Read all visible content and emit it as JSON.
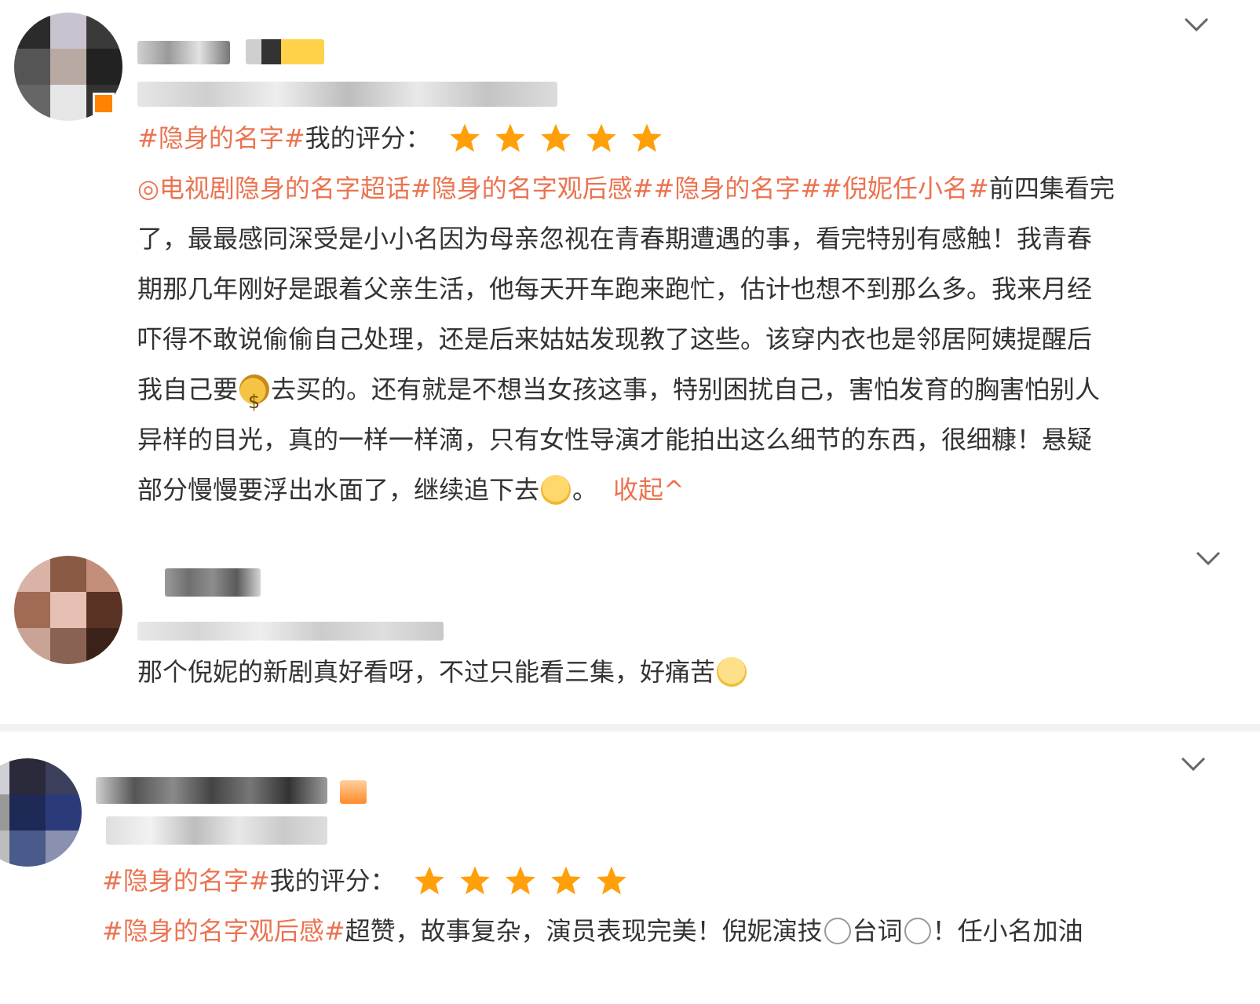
{
  "accent_color": "#eb7350",
  "star_color": "#ff9f0a",
  "posts": [
    {
      "rating_tag": "#隐身的名字#",
      "rating_label": "我的评分：",
      "stars": 5,
      "body": {
        "l1_tags": "◎电视剧隐身的名字超话#隐身的名字观后感##隐身的名字##倪妮任小名#",
        "l1_text": " 前四集看完",
        "l2": "了，最最感同深受是小小名因为母亲忽视在青春期遭遇的事，看完特别有感触！我青春",
        "l3": "期那几年刚好是跟着父亲生活，他每天开车跑来跑忙，估计也想不到那么多。我来月经",
        "l4": "吓得不敢说偷偷自己处理，还是后来姑姑发现教了这些。该穿内衣也是邻居阿姨提醒后",
        "l5a": "我自己要",
        "l5b": "去买的。还有就是不想当女孩这事，特别困扰自己，害怕发育的胸害怕别人",
        "l6": "异样的目光，真的一样一样滴，只有女性导演才能拍出这么细节的东西，很细糠！悬疑",
        "l7": "部分慢慢要浮出水面了，继续追下去",
        "l7_end": "。",
        "collapse": "收起^"
      },
      "icons": {
        "emoji_1": "money-bag-emoji",
        "emoji_2": "crying-face-emoji",
        "menu": "chevron-down-icon"
      }
    },
    {
      "body": "那个倪妮的新剧真好看呀，不过只能看三集，好痛苦",
      "icons": {
        "emoji": "smiling-face-emoji",
        "menu": "chevron-down-icon"
      }
    },
    {
      "rating_tag": "#隐身的名字#",
      "rating_label": "我的评分：",
      "stars": 5,
      "body": {
        "tag": "#隐身的名字观后感#",
        "t1": "超赞，故事复杂，演员表现完美！倪妮演技",
        "t2": "台词",
        "t3": "！任小名加油"
      },
      "icons": {
        "emoji": "face-emoji",
        "menu": "chevron-down-icon"
      }
    }
  ]
}
